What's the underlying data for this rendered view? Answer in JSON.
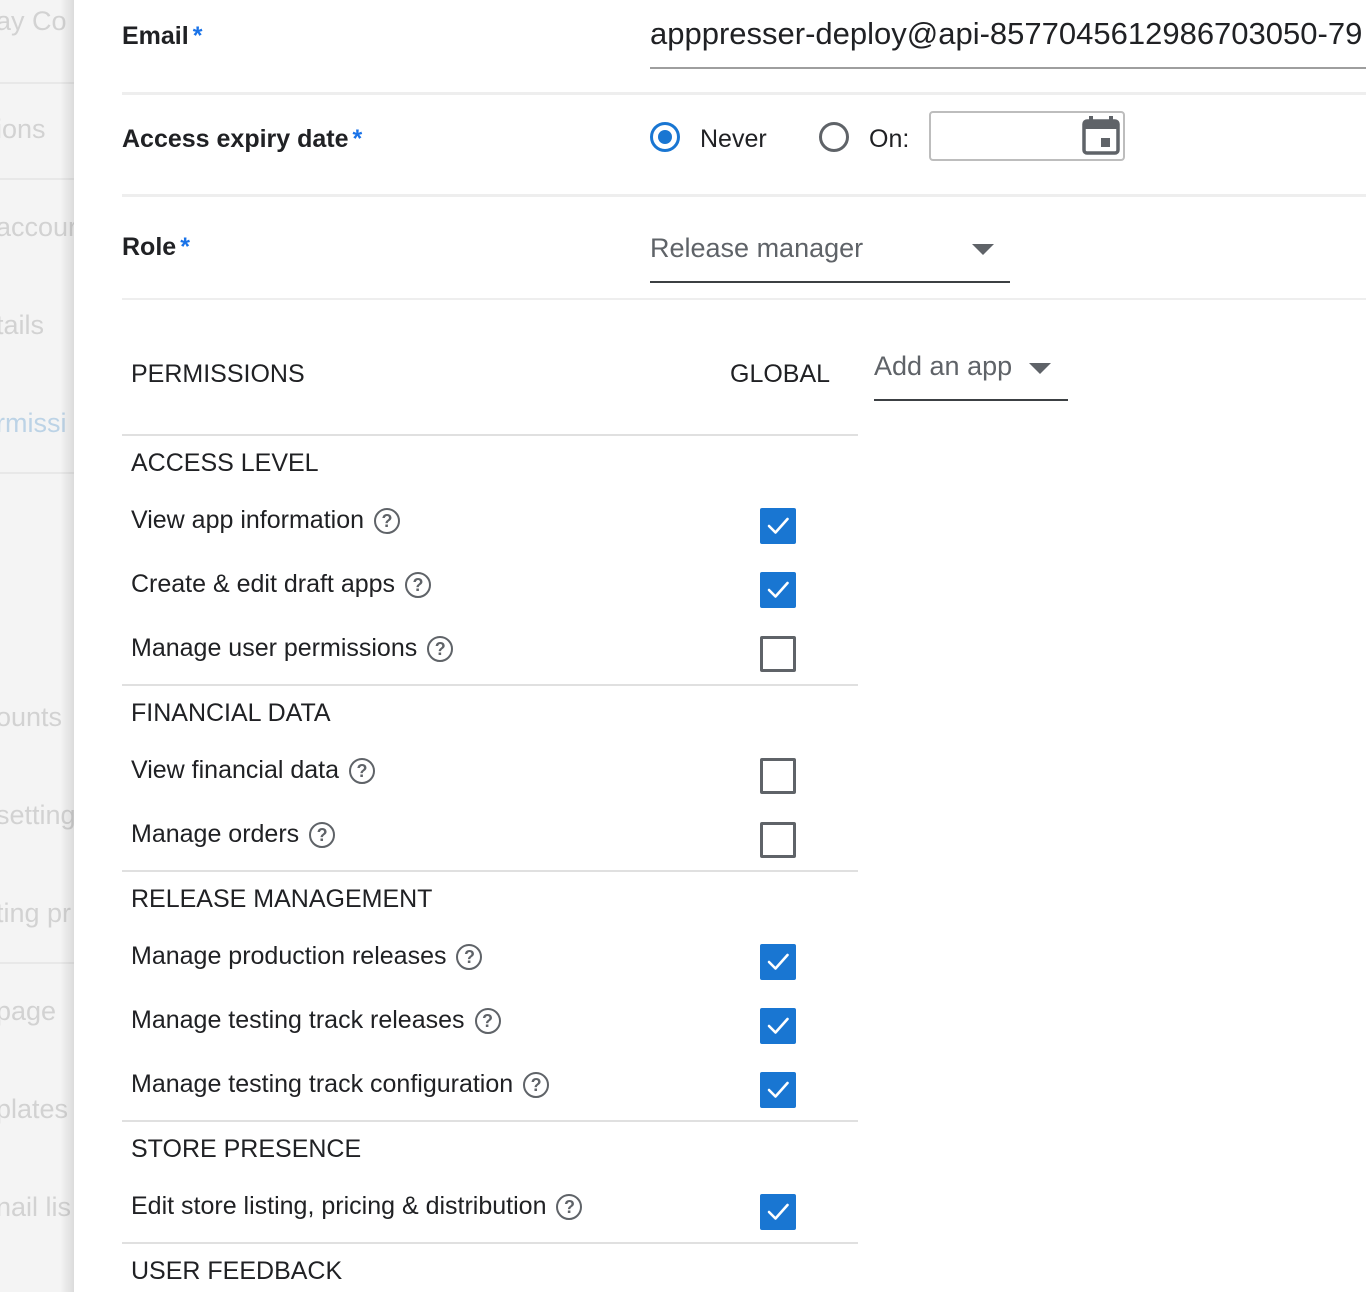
{
  "sidebar": {
    "items": [
      {
        "label": "ay Co",
        "active": false
      },
      {
        "label": "ions",
        "active": false
      },
      {
        "label": "accour",
        "active": false
      },
      {
        "label": "tails",
        "active": false
      },
      {
        "label": "rmissi",
        "active": true
      },
      {
        "label": "ounts",
        "active": false
      },
      {
        "label": "setting",
        "active": false
      },
      {
        "label": "ting pr",
        "active": false
      },
      {
        "label": "page",
        "active": false
      },
      {
        "label": "plates",
        "active": false
      },
      {
        "label": "nail lis",
        "active": false
      }
    ]
  },
  "form": {
    "email_label": "Email",
    "email_value": "apppresser-deploy@api-8577045612986703050-79",
    "expiry_label": "Access expiry date",
    "never_label": "Never",
    "on_label": "On:",
    "role_label": "Role",
    "role_value": "Release manager",
    "required_mark": "*"
  },
  "permissions": {
    "header": "PERMISSIONS",
    "global_header": "GLOBAL",
    "add_app_label": "Add an app",
    "help_glyph": "?",
    "sections": [
      {
        "title": "ACCESS LEVEL",
        "items": [
          {
            "label": "View app information",
            "checked": true
          },
          {
            "label": "Create & edit draft apps",
            "checked": true
          },
          {
            "label": "Manage user permissions",
            "checked": false
          }
        ]
      },
      {
        "title": "FINANCIAL DATA",
        "items": [
          {
            "label": "View financial data",
            "checked": false
          },
          {
            "label": "Manage orders",
            "checked": false
          }
        ]
      },
      {
        "title": "RELEASE MANAGEMENT",
        "items": [
          {
            "label": "Manage production releases",
            "checked": true
          },
          {
            "label": "Manage testing track releases",
            "checked": true
          },
          {
            "label": "Manage testing track configuration",
            "checked": true
          }
        ]
      },
      {
        "title": "STORE PRESENCE",
        "items": [
          {
            "label": "Edit store listing, pricing & distribution",
            "checked": true
          }
        ]
      },
      {
        "title": "USER FEEDBACK",
        "items": []
      }
    ]
  },
  "colors": {
    "accent": "#1976d2",
    "required": "#1a73e8"
  },
  "icons": {
    "calendar": "calendar-icon",
    "help": "help-circle-icon",
    "dropdown": "caret-down-icon"
  }
}
